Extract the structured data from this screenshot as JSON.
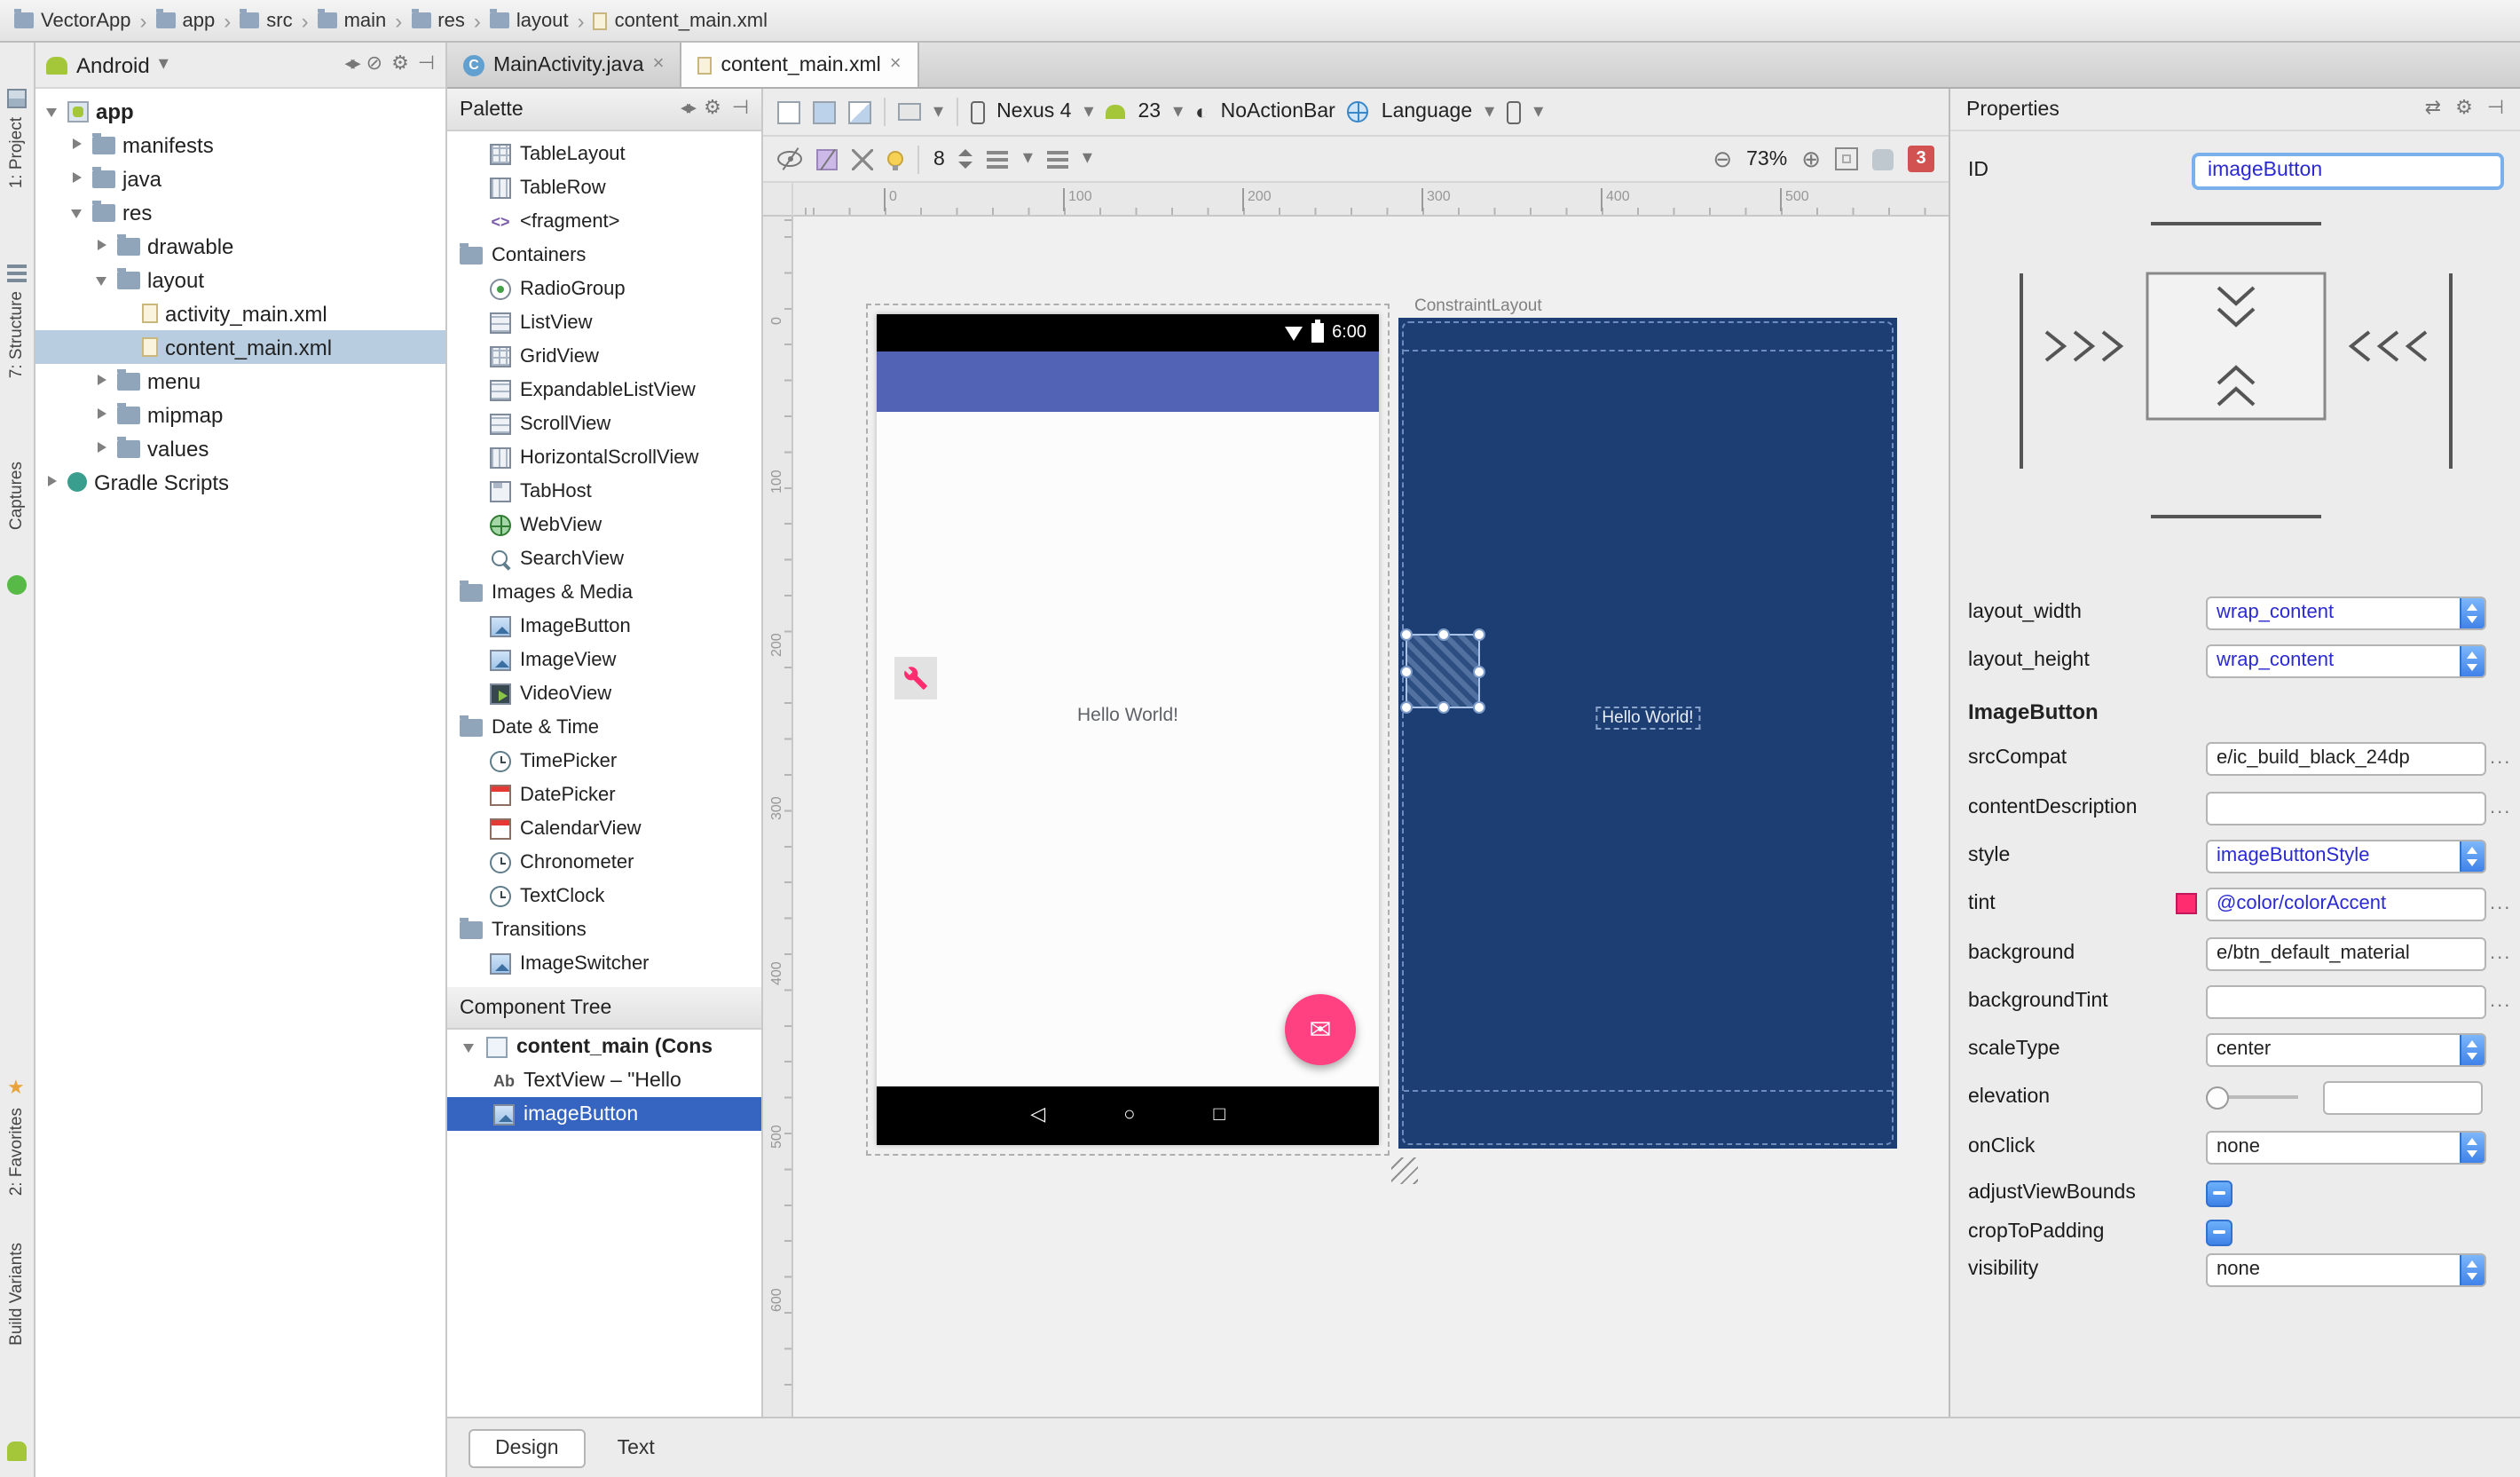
{
  "colors": {
    "accent_pink": "#ff4081",
    "appbar_indigo": "#5262b4",
    "blueprint_blue": "#1d3e72",
    "selection_blue": "#3565c0",
    "android_green": "#a4c639",
    "error_red": "#d25252"
  },
  "breadcrumbs": {
    "items": [
      "VectorApp",
      "app",
      "src",
      "main",
      "res",
      "layout",
      "content_main.xml"
    ]
  },
  "tool_strip": {
    "top": [
      "1: Project",
      "7: Structure",
      "Captures"
    ],
    "bottom": [
      "2: Favorites",
      "Build Variants"
    ]
  },
  "project": {
    "selector": "Android",
    "tree": [
      "app",
      "manifests",
      "java",
      "res",
      "drawable",
      "layout",
      "activity_main.xml",
      "content_main.xml",
      "menu",
      "mipmap",
      "values",
      "Gradle Scripts"
    ]
  },
  "editor_tabs": {
    "tab1": "MainActivity.java",
    "tab2": "content_main.xml"
  },
  "palette": {
    "title": "Palette",
    "items": [
      "TableLayout",
      "TableRow",
      "<fragment>",
      "Containers",
      "RadioGroup",
      "ListView",
      "GridView",
      "ExpandableListView",
      "ScrollView",
      "HorizontalScrollView",
      "TabHost",
      "WebView",
      "SearchView",
      "Images & Media",
      "ImageButton",
      "ImageView",
      "VideoView",
      "Date & Time",
      "TimePicker",
      "DatePicker",
      "CalendarView",
      "Chronometer",
      "TextClock",
      "Transitions",
      "ImageSwitcher"
    ]
  },
  "component_tree": {
    "title": "Component Tree",
    "items": [
      "content_main (Cons",
      "TextView – \"Hello",
      "imageButton"
    ]
  },
  "design_toolbar": {
    "device": "Nexus 4",
    "api": "23",
    "theme": "NoActionBar",
    "language": "Language",
    "margin": "8",
    "zoom": "73%",
    "errors": "3"
  },
  "canvas": {
    "ruler_h": [
      "0",
      "100",
      "200",
      "300",
      "400",
      "500"
    ],
    "ruler_v": [
      "0",
      "100",
      "200",
      "300",
      "400",
      "500",
      "600"
    ],
    "status_time": "6:00",
    "design_hello": "Hello World!",
    "blueprint_label": "ConstraintLayout",
    "blueprint_hello": "Hello World!"
  },
  "properties": {
    "title": "Properties",
    "id_label": "ID",
    "id_value": "imageButton",
    "layout_width_label": "layout_width",
    "layout_width_value": "wrap_content",
    "layout_height_label": "layout_height",
    "layout_height_value": "wrap_content",
    "section": "ImageButton",
    "srccompat_label": "srcCompat",
    "srccompat_value": "e/ic_build_black_24dp",
    "contentdescription_label": "contentDescription",
    "contentdescription_value": "",
    "style_label": "style",
    "style_value": "imageButtonStyle",
    "tint_label": "tint",
    "tint_value": "@color/colorAccent",
    "background_label": "background",
    "background_value": "e/btn_default_material",
    "backgroundtint_label": "backgroundTint",
    "backgroundtint_value": "",
    "scaletype_label": "scaleType",
    "scaletype_value": "center",
    "elevation_label": "elevation",
    "elevation_value": "",
    "onclick_label": "onClick",
    "onclick_value": "none",
    "adjustviewbounds_label": "adjustViewBounds",
    "croptopadding_label": "cropToPadding",
    "visibility_label": "visibility",
    "visibility_value": "none",
    "more": "..."
  },
  "bottom_tabs": {
    "design": "Design",
    "text": "Text"
  }
}
